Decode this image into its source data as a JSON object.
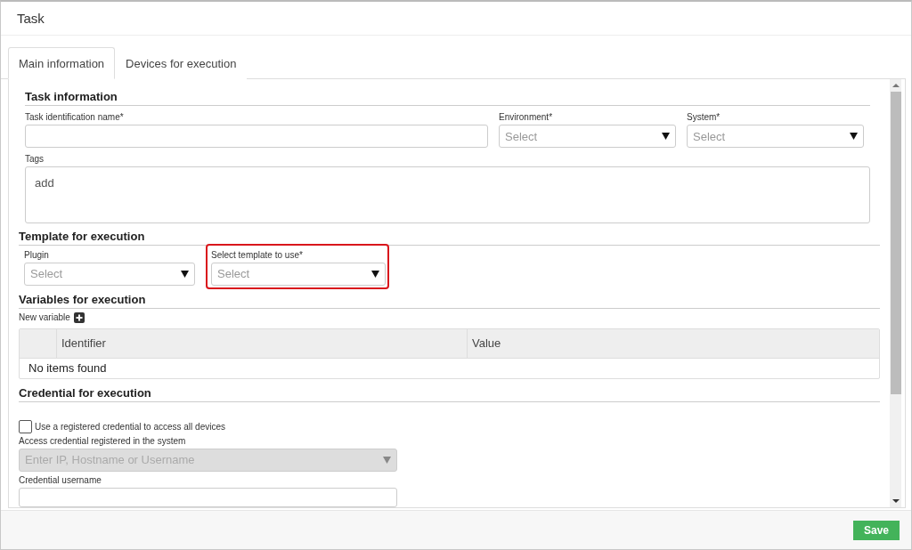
{
  "dialog": {
    "title": "Task"
  },
  "tabs": [
    {
      "label": "Main information",
      "selected": true
    },
    {
      "label": "Devices for execution",
      "selected": false
    }
  ],
  "task_information": {
    "heading": "Task information",
    "fields": [
      {
        "kind": "text",
        "label": "Task identification name*"
      },
      {
        "kind": "select",
        "label": "Environment*",
        "placeholder": "Select"
      },
      {
        "kind": "select",
        "label": "System*",
        "placeholder": "Select"
      }
    ],
    "tags": {
      "label": "Tags",
      "value": "add"
    }
  },
  "template": {
    "heading": "Template for execution",
    "fields": [
      {
        "label": "Plugin",
        "placeholder": "Select",
        "highlighted": false
      },
      {
        "label": "Select template to use*",
        "placeholder": "Select",
        "highlighted": true
      }
    ]
  },
  "variables": {
    "heading": "Variables for execution",
    "new_variable": "New variable",
    "columns": [
      "Identifier",
      "Value"
    ],
    "empty_message": "No items found"
  },
  "credential": {
    "heading": "Credential for execution",
    "checkbox": {
      "label": "Use a registered credential to access all devices",
      "checked": false
    },
    "access": {
      "label": "Access credential registered in the system",
      "placeholder": "Enter IP, Hostname or Username",
      "disabled": true
    },
    "username": {
      "label": "Credential username"
    }
  },
  "footer": {
    "save": "Save"
  }
}
